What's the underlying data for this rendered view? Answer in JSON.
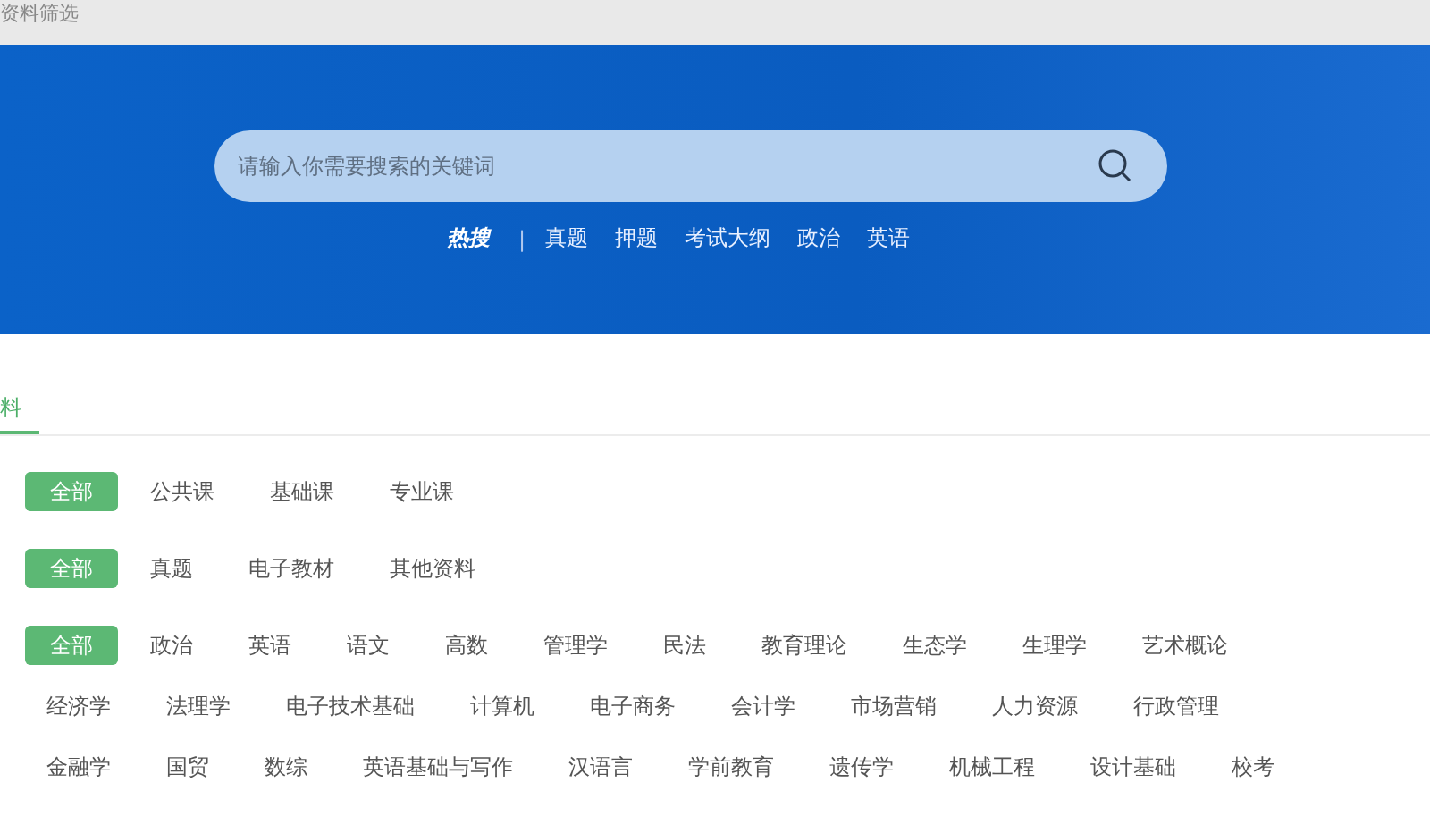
{
  "window": {
    "title": "资料筛选"
  },
  "search": {
    "placeholder": "请输入你需要搜索的关键词"
  },
  "hot": {
    "label": "热搜",
    "separator": "|",
    "links": [
      "真题",
      "押题",
      "考试大纲",
      "政治",
      "英语"
    ]
  },
  "tabs": [
    {
      "label": "料",
      "selected": true
    }
  ],
  "filters": [
    {
      "options": [
        {
          "label": "全部",
          "selected": true
        },
        {
          "label": "公共课",
          "selected": false
        },
        {
          "label": "基础课",
          "selected": false
        },
        {
          "label": "专业课",
          "selected": false
        }
      ]
    },
    {
      "options": [
        {
          "label": "全部",
          "selected": true
        },
        {
          "label": "真题",
          "selected": false
        },
        {
          "label": "电子教材",
          "selected": false
        },
        {
          "label": "其他资料",
          "selected": false
        }
      ]
    },
    {
      "options": [
        {
          "label": "全部",
          "selected": true
        },
        {
          "label": "政治",
          "selected": false
        },
        {
          "label": "英语",
          "selected": false
        },
        {
          "label": "语文",
          "selected": false
        },
        {
          "label": "高数",
          "selected": false
        },
        {
          "label": "管理学",
          "selected": false
        },
        {
          "label": "民法",
          "selected": false
        },
        {
          "label": "教育理论",
          "selected": false
        },
        {
          "label": "生态学",
          "selected": false
        },
        {
          "label": "生理学",
          "selected": false
        },
        {
          "label": "艺术概论",
          "selected": false
        },
        {
          "label": "经济学",
          "selected": false
        },
        {
          "label": "法理学",
          "selected": false
        },
        {
          "label": "电子技术基础",
          "selected": false
        },
        {
          "label": "计算机",
          "selected": false
        },
        {
          "label": "电子商务",
          "selected": false
        },
        {
          "label": "会计学",
          "selected": false
        },
        {
          "label": "市场营销",
          "selected": false
        },
        {
          "label": "人力资源",
          "selected": false
        },
        {
          "label": "行政管理",
          "selected": false
        },
        {
          "label": "金融学",
          "selected": false
        },
        {
          "label": "国贸",
          "selected": false
        },
        {
          "label": "数综",
          "selected": false
        },
        {
          "label": "英语基础与写作",
          "selected": false
        },
        {
          "label": "汉语言",
          "selected": false
        },
        {
          "label": "学前教育",
          "selected": false
        },
        {
          "label": "遗传学",
          "selected": false
        },
        {
          "label": "机械工程",
          "selected": false
        },
        {
          "label": "设计基础",
          "selected": false
        },
        {
          "label": "校考",
          "selected": false
        }
      ]
    }
  ]
}
